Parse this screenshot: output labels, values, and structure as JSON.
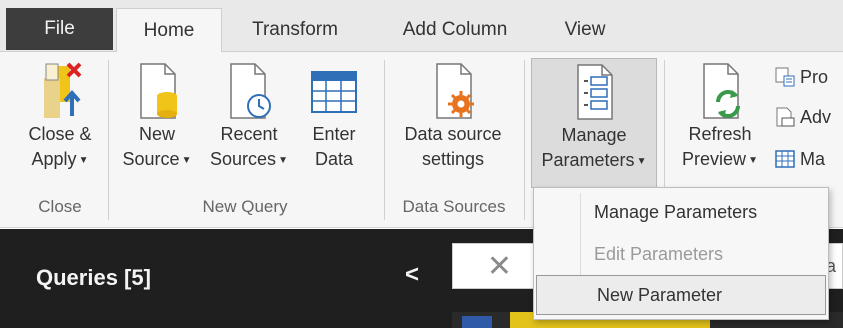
{
  "tabs": {
    "file": "File",
    "home": "Home",
    "transform": "Transform",
    "add_column": "Add Column",
    "view": "View"
  },
  "ribbon": {
    "close_group": {
      "label": "Close",
      "close_apply_line1": "Close &",
      "close_apply_line2": "Apply"
    },
    "new_query_group": {
      "label": "New Query",
      "new_source_line1": "New",
      "new_source_line2": "Source",
      "recent_sources_line1": "Recent",
      "recent_sources_line2": "Sources",
      "enter_data_line1": "Enter",
      "enter_data_line2": "Data"
    },
    "data_sources_group": {
      "label": "Data Sources",
      "settings_line1": "Data source",
      "settings_line2": "settings"
    },
    "parameters_group": {
      "manage_line1": "Manage",
      "manage_line2": "Parameters"
    },
    "query_group": {
      "refresh_line1": "Refresh",
      "refresh_line2": "Preview",
      "properties": "Pro",
      "advanced": "Adv",
      "manage": "Ma"
    }
  },
  "queries_pane": {
    "title": "Queries [5]",
    "collapse_glyph": "<"
  },
  "editor": {
    "cancel_glyph": "✕",
    "right_fragment": "a"
  },
  "dropdown": {
    "items": [
      {
        "label": "Manage Parameters",
        "enabled": true
      },
      {
        "label": "Edit Parameters",
        "enabled": false
      },
      {
        "label": "New Parameter",
        "enabled": true
      }
    ]
  },
  "colors": {
    "file_tab": "#3d3d3d",
    "ribbon_bg": "#f6f6f6",
    "dark_pane": "#1f1f1f",
    "accent_orange": "#e8731e",
    "accent_green": "#3a9a4a",
    "accent_blue": "#2f6fb8",
    "accent_yellow": "#f0c419"
  }
}
